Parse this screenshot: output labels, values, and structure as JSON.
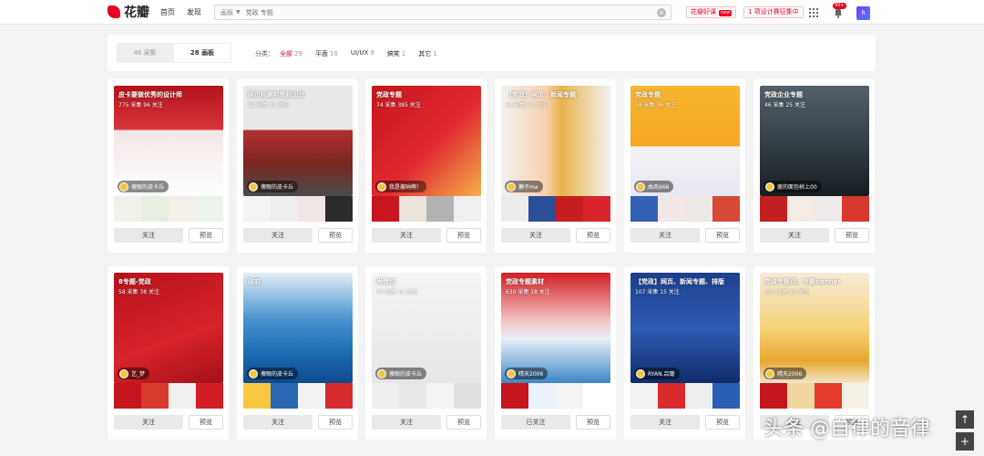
{
  "header": {
    "logo_text": "花瓣",
    "nav": [
      "首页",
      "发现"
    ],
    "search_scope": "画板",
    "search_placeholder": "党政 专题",
    "link1": "花瓣好课",
    "link1_badge": "new",
    "link2": "1 项设计赛征集中",
    "bell_badge": "99+",
    "avatar_text": "R"
  },
  "filter": {
    "tabs": [
      {
        "label": "46 采集"
      },
      {
        "label": "28 画板"
      }
    ],
    "cat_label": "分类：",
    "cats": [
      {
        "name": "全部",
        "count": "29"
      },
      {
        "name": "平面",
        "count": "10"
      },
      {
        "name": "UI/UX",
        "count": "9"
      },
      {
        "name": "搞笑",
        "count": "1"
      },
      {
        "name": "其它",
        "count": "1"
      }
    ]
  },
  "buttons": {
    "follow": "关注",
    "followed": "已关注",
    "preview": "预览"
  },
  "boards": [
    {
      "title": "皮卡要做优秀的设计师",
      "meta": "775 采集  96 关注",
      "owner": "傻眼的皮卡丘",
      "followed": false,
      "cover_bg": "linear-gradient(180deg,#b3131a 0%,#d9353a 40%,#f2e6e6 40%,#fff 100%)",
      "thumbs": [
        "#f1f1ea",
        "#e7efe3",
        "#f3efe9",
        "#ecf3ea"
      ]
    },
    {
      "title": "网页标题栏图标设计",
      "meta": "22 采集  11 关注",
      "owner": "傻眼的皮卡丘",
      "followed": false,
      "cover_bg": "linear-gradient(180deg,#e8e8e8 0%,#e8e8e8 40%,#b4302e 40%,#7a2622 70%,#4b4b4b 100%)",
      "thumbs": [
        "#f4f4f4",
        "#eeeeee",
        "#efe6e6",
        "#2b2b2b"
      ]
    },
    {
      "title": "党政专题",
      "meta": "74 采集  385 关注",
      "owner": "我是酱呐啊！",
      "followed": false,
      "cover_bg": "linear-gradient(135deg,#c4161c 0%,#e1292f 55%,#f3b04a 100%)",
      "thumbs": [
        "#c9161e",
        "#ece4da",
        "#b2b2b2",
        "#f0eeee"
      ]
    },
    {
      "title": "【党政】网页、新闻专题",
      "meta": "44 采集  74 关注",
      "owner": "獭子ma",
      "followed": false,
      "cover_bg": "linear-gradient(90deg,#f2f2f2 0%,#f7d3b0 40%,#e9b34b 55%,#f2f2f2 100%)",
      "thumbs": [
        "#ececec",
        "#2c4f9a",
        "#c71e22",
        "#d9252a"
      ]
    },
    {
      "title": "党政专题",
      "meta": "58 采集  36 关注",
      "owner": "曲风666",
      "followed": false,
      "cover_bg": "linear-gradient(180deg,#f8b62e 0%,#f5a623 55%,#f2f2f2 55%,#e7e7f5 100%)",
      "thumbs": [
        "#3261b5",
        "#f2e6e6",
        "#ece9e4",
        "#d84a37"
      ]
    },
    {
      "title": "党政企业专题",
      "meta": "46 采集  25 关注",
      "owner": "疲的面包树上00",
      "followed": false,
      "cover_bg": "linear-gradient(180deg,#54606a 0%,#2f3a40 60%,#171d21 100%)",
      "thumbs": [
        "#c2211f",
        "#f4ece4",
        "#efeaea",
        "#d83730"
      ]
    },
    {
      "title": "8专题-党政",
      "meta": "58 采集  38 关注",
      "owner": "艺_梦",
      "followed": false,
      "cover_bg": "linear-gradient(160deg,#b6121a 0%,#d8242b 60%,#a20f15 100%)",
      "thumbs": [
        "#c4161c",
        "#d73b2d",
        "#f2efef",
        "#d31e26"
      ]
    },
    {
      "title": "政府",
      "meta": "",
      "owner": "傻眼的皮卡丘",
      "followed": false,
      "cover_bg": "linear-gradient(180deg,#e3eef7 0%,#4e97d0 40%,#1e6fb6 70%,#0e4a8f 100%)",
      "thumbs": [
        "#f8c842",
        "#2a68b4",
        "#f2f2f2",
        "#d62c2f"
      ]
    },
    {
      "title": "表情包",
      "meta": "73 采集  11 关注",
      "owner": "傻眼的皮卡丘",
      "followed": false,
      "cover_bg": "linear-gradient(180deg,#f4f4f4 0%,#e6e6e6 100%)",
      "thumbs": [
        "#eeeeee",
        "#e8e8e8",
        "#f3f3f3",
        "#dfdfdf"
      ]
    },
    {
      "title": "党政专题素材",
      "meta": "630 采集  18 关注",
      "owner": "晴天2006",
      "followed": true,
      "cover_bg": "linear-gradient(180deg,#d41d22 0%,#f3c9c9 45%,#e8f0f8 60%,#3d86c6 100%)",
      "thumbs": [
        "#c4161c",
        "#eaf1fa",
        "#f3f3f3",
        "#ffffff"
      ]
    },
    {
      "title": "【党政】网页、新闻专题、排版",
      "meta": "107 采集  15 关注",
      "owner": "RYAN.吕璐",
      "followed": false,
      "cover_bg": "linear-gradient(180deg,#1c3f8e 0%,#2e5db3 50%,#0f2c6b 100%)",
      "thumbs": [
        "#f1f1f1",
        "#d82b2e",
        "#ededed",
        "#2b5fb4"
      ]
    },
    {
      "title": "党政专题页、专题banner",
      "meta": "320 采集  12 关注",
      "owner": "晴天2006",
      "followed": false,
      "cover_bg": "linear-gradient(180deg,#f5ecd8 0%,#f6d27a 50%,#e9a730 80%,#f2e6c8 100%)",
      "thumbs": [
        "#c4161c",
        "#f0d7a0",
        "#e33b2c",
        "#f5f0e6"
      ]
    }
  ],
  "watermark": "头条 @自律的音律"
}
